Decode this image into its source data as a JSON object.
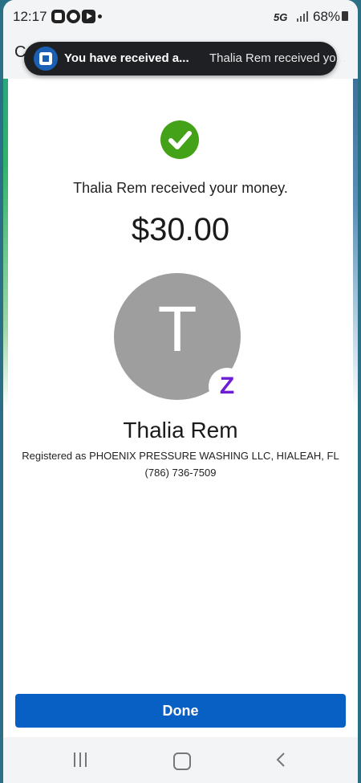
{
  "status_bar": {
    "time": "12:17",
    "network": "5G",
    "battery": "68%",
    "icons": [
      "chase-app-icon",
      "radio-app-icon",
      "youtube-icon",
      "dot-icon",
      "signal-icon",
      "battery-icon"
    ]
  },
  "app_header": {
    "partial_title": "C"
  },
  "notification": {
    "title": "You have received a...",
    "body": "Thalia Rem received yo...",
    "icon": "chase-logo-icon"
  },
  "confirmation": {
    "status_icon": "check-circle-icon",
    "message": "Thalia Rem received your money.",
    "amount": "$30.00"
  },
  "recipient": {
    "initial": "T",
    "badge_icon": "zelle-icon",
    "badge_glyph": "Z",
    "name": "Thalia Rem",
    "registered": "Registered as PHOENIX PRESSURE WASHING LLC, HIALEAH, FL",
    "phone": "(786) 736-7509"
  },
  "actions": {
    "done_label": "Done"
  },
  "nav_bar": {
    "icons": [
      "recents-icon",
      "home-icon",
      "back-icon"
    ]
  },
  "colors": {
    "accent": "#0860c4",
    "success": "#43a218",
    "zelle": "#6d1ed4",
    "avatar": "#9e9e9e"
  }
}
